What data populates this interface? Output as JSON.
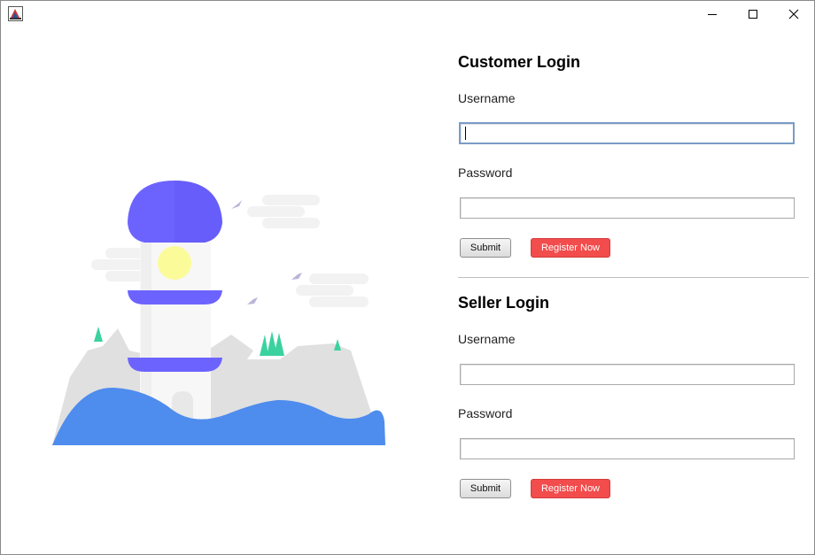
{
  "window": {
    "controls": {
      "minimize_icon": "minimize-icon",
      "maximize_icon": "maximize-icon",
      "close_icon": "close-icon"
    },
    "app_icon": "app-icon"
  },
  "illustration": {
    "subject": "lighthouse-illustration",
    "colors": {
      "lamp": "#6c63ff",
      "light": "#fbfb9a",
      "water": "#4e8cee",
      "rocks": "#e0e0e0",
      "grass": "#3ad29f",
      "cloud": "#f2f2f2"
    }
  },
  "customer_login": {
    "heading": "Customer Login",
    "username_label": "Username",
    "username_value": "",
    "password_label": "Password",
    "password_value": "",
    "submit_label": "Submit",
    "register_label": "Register Now"
  },
  "seller_login": {
    "heading": "Seller Login",
    "username_label": "Username",
    "username_value": "",
    "password_label": "Password",
    "password_value": "",
    "submit_label": "Submit",
    "register_label": "Register Now"
  },
  "colors": {
    "register_button": "#f24c4c",
    "focus_border": "#7a9cc6"
  }
}
